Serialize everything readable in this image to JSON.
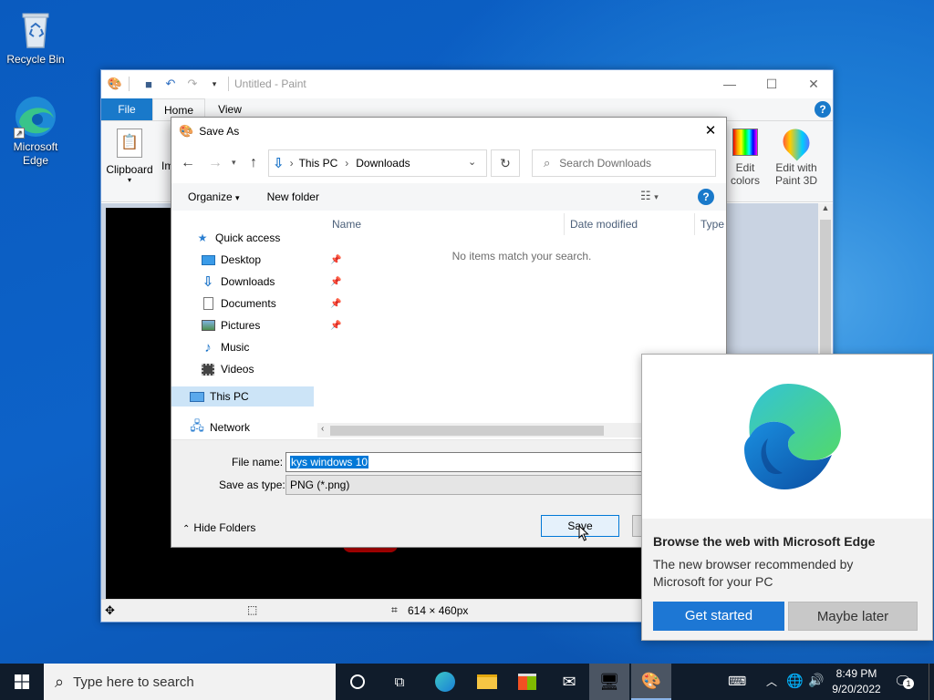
{
  "desktop": {
    "icons": [
      {
        "label": "Recycle Bin",
        "icon": "recycle-bin-icon"
      },
      {
        "label": "Microsoft Edge",
        "icon": "edge-icon"
      }
    ]
  },
  "paint": {
    "title": "Untitled - Paint",
    "tabs": [
      "File",
      "Home",
      "View"
    ],
    "ribbon": {
      "clipboard": "Clipboard",
      "image_partial": "Im",
      "edit_colors": "Edit colors",
      "edit_colors_l1": "Edit",
      "edit_colors_l2": "colors",
      "edit_paint3d_l1": "Edit with",
      "edit_paint3d_l2": "Paint 3D"
    },
    "status": {
      "dimensions": "614 × 460px"
    },
    "help": "?"
  },
  "save_dialog": {
    "title": "Save As",
    "breadcrumb": [
      "This PC",
      "Downloads"
    ],
    "search_placeholder": "Search Downloads",
    "organize": "Organize",
    "new_folder": "New folder",
    "nav": [
      {
        "label": "Quick access",
        "icon": "star-icon"
      },
      {
        "label": "Desktop",
        "icon": "desktop-icon",
        "pinned": true
      },
      {
        "label": "Downloads",
        "icon": "download-icon",
        "pinned": true
      },
      {
        "label": "Documents",
        "icon": "document-icon",
        "pinned": true
      },
      {
        "label": "Pictures",
        "icon": "pictures-icon",
        "pinned": true
      },
      {
        "label": "Music",
        "icon": "music-icon"
      },
      {
        "label": "Videos",
        "icon": "video-icon"
      },
      {
        "label": "This PC",
        "icon": "computer-icon",
        "selected": true
      },
      {
        "label": "Network",
        "icon": "network-icon"
      }
    ],
    "columns": [
      "Name",
      "Date modified",
      "Type"
    ],
    "empty_message": "No items match your search.",
    "file_name_label": "File name:",
    "file_name_value": "kys windows 10",
    "save_type_label": "Save as type:",
    "save_type_value": "PNG (*.png)",
    "hide_folders": "Hide Folders",
    "save_button": "Save"
  },
  "edge_popup": {
    "heading": "Browse the web with Microsoft Edge",
    "body": "The new browser recommended by Microsoft for your PC",
    "primary": "Get started",
    "secondary": "Maybe later",
    "accent": "#0f6cbd"
  },
  "taskbar": {
    "search_placeholder": "Type here to search",
    "time": "8:49 PM",
    "date": "9/20/2022",
    "notification_count": "1"
  }
}
